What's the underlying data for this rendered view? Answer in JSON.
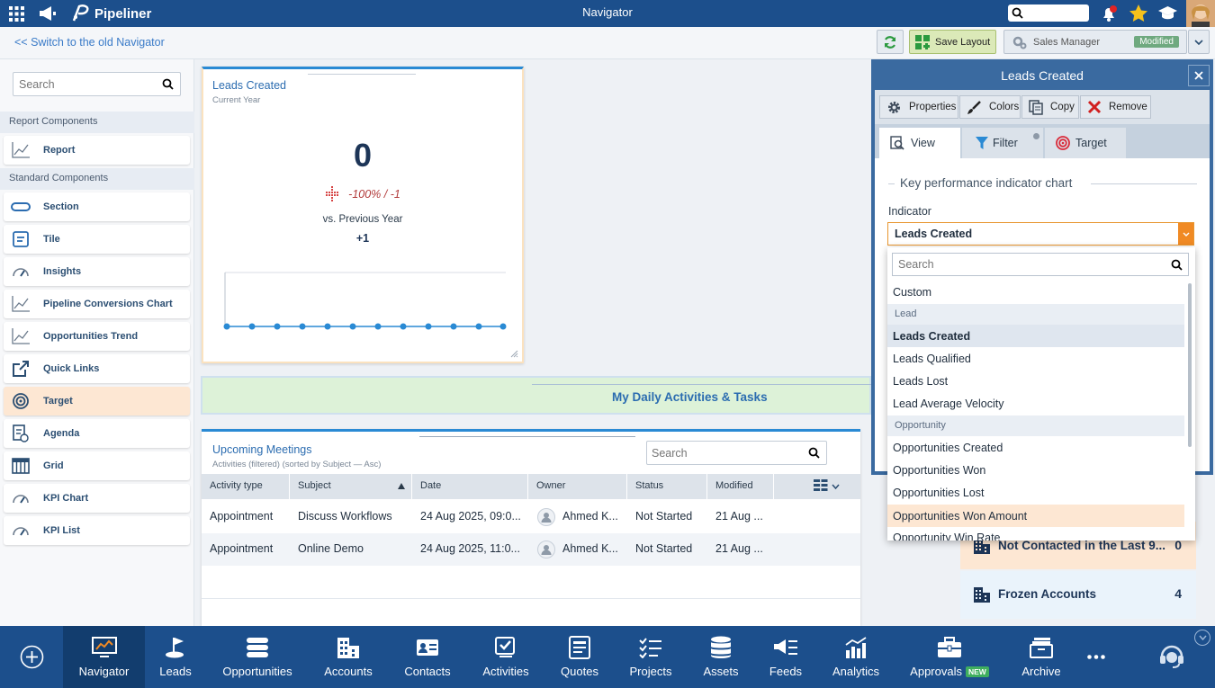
{
  "app": {
    "title": "Navigator",
    "brand": "Pipeliner"
  },
  "topbar": {
    "search_placeholder": ""
  },
  "subbar": {
    "old_nav_link": "<< Switch to the old Navigator",
    "save_layout": "Save Layout",
    "profile": "Sales Manager",
    "modified_badge": "Modified"
  },
  "leftpanel": {
    "search_placeholder": "Search",
    "report_section": "Report Components",
    "report_items": [
      {
        "label": "Report",
        "icon": "line-chart-icon"
      }
    ],
    "standard_section": "Standard Components",
    "standard_items": [
      {
        "label": "Section",
        "icon": "section-icon"
      },
      {
        "label": "Tile",
        "icon": "tile-icon"
      },
      {
        "label": "Insights",
        "icon": "gauge-icon"
      },
      {
        "label": "Pipeline Conversions Chart",
        "icon": "line-chart-icon"
      },
      {
        "label": "Opportunities Trend",
        "icon": "line-chart-icon"
      },
      {
        "label": "Quick Links",
        "icon": "external-link-icon"
      },
      {
        "label": "Target",
        "icon": "target-icon"
      },
      {
        "label": "Agenda",
        "icon": "agenda-icon"
      },
      {
        "label": "Grid",
        "icon": "grid-icon"
      },
      {
        "label": "KPI Chart",
        "icon": "gauge-icon"
      },
      {
        "label": "KPI List",
        "icon": "gauge-icon"
      }
    ]
  },
  "kpi_card": {
    "title": "Leads Created",
    "subtitle": "Current Year",
    "value": "0",
    "change": "-100% / -1",
    "comparison": "vs. Previous Year",
    "delta": "+1"
  },
  "section_banner": {
    "title": "My Daily Activities & Tasks"
  },
  "meetings": {
    "title": "Upcoming Meetings",
    "subtitle": "Activities (filtered) (sorted by Subject — Asc)",
    "search_placeholder": "Search",
    "columns": [
      "Activity type",
      "Subject",
      "Date",
      "Owner",
      "Status",
      "Modified"
    ],
    "rows": [
      {
        "type": "Appointment",
        "subject": "Discuss Workflows",
        "date": "24 Aug 2025, 09:0...",
        "owner": "Ahmed K...",
        "status": "Not Started",
        "modified": "21 Aug ..."
      },
      {
        "type": "Appointment",
        "subject": "Online Demo",
        "date": "24 Aug 2025, 11:0...",
        "owner": "Ahmed K...",
        "status": "Not Started",
        "modified": "21 Aug ..."
      }
    ]
  },
  "accounts_list": [
    {
      "label": "Not Contacted in the Last 9...",
      "count": "0"
    },
    {
      "label": "Frozen Accounts",
      "count": "4"
    }
  ],
  "properties_panel": {
    "title": "Leads Created",
    "toolbar": [
      "Properties",
      "Colors",
      "Copy",
      "Remove"
    ],
    "tabs": [
      "View",
      "Filter",
      "Target"
    ],
    "section_title": "Key performance indicator chart",
    "indicator_label": "Indicator",
    "indicator_value": "Leads Created",
    "dropdown": {
      "search_placeholder": "Search",
      "custom": "Custom",
      "lead_group": "Lead",
      "lead_options": [
        "Leads Created",
        "Leads Qualified",
        "Leads Lost",
        "Lead Average Velocity"
      ],
      "opportunity_group": "Opportunity",
      "opportunity_options": [
        "Opportunities Created",
        "Opportunities Won",
        "Opportunities Lost",
        "Opportunities Won Amount",
        "Opportunity Win Rate"
      ]
    }
  },
  "bottom_nav": [
    {
      "label": "Navigator",
      "icon": "monitor-chart-icon"
    },
    {
      "label": "Leads",
      "icon": "golf-flag-icon"
    },
    {
      "label": "Opportunities",
      "icon": "stack-icon"
    },
    {
      "label": "Accounts",
      "icon": "building-icon"
    },
    {
      "label": "Contacts",
      "icon": "contact-card-icon"
    },
    {
      "label": "Activities",
      "icon": "activities-icon"
    },
    {
      "label": "Quotes",
      "icon": "quote-icon"
    },
    {
      "label": "Projects",
      "icon": "checklist-icon"
    },
    {
      "label": "Assets",
      "icon": "database-icon"
    },
    {
      "label": "Feeds",
      "icon": "feeds-icon"
    },
    {
      "label": "Analytics",
      "icon": "analytics-icon"
    },
    {
      "label": "Approvals",
      "icon": "briefcase-icon",
      "badge": "NEW"
    },
    {
      "label": "Archive",
      "icon": "archive-icon"
    }
  ]
}
